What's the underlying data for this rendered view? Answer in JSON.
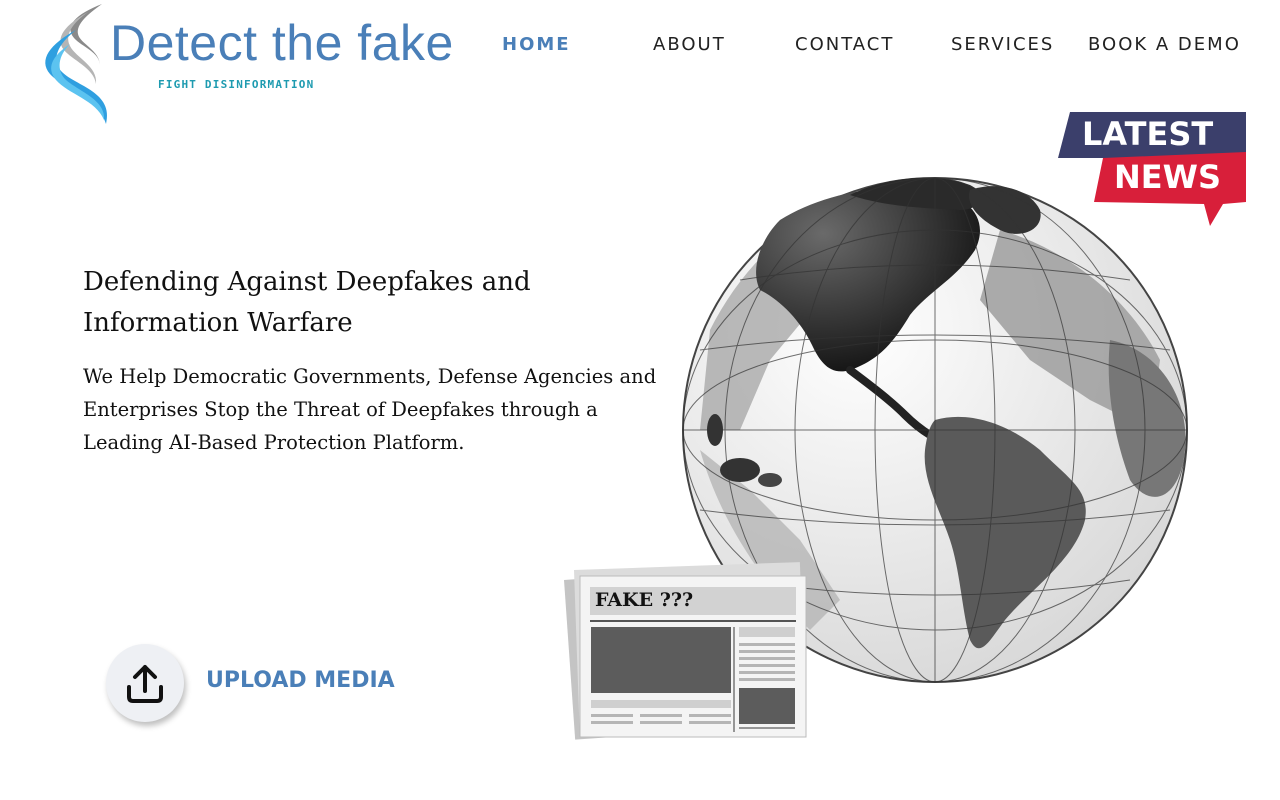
{
  "brand": {
    "name": "Detect the fake",
    "tagline": "FIGHT DISINFORMATION",
    "color": "#4a7fb8",
    "tagline_color": "#1e9bb0"
  },
  "nav": {
    "items": [
      {
        "label": "HOME",
        "active": true
      },
      {
        "label": "ABOUT",
        "active": false
      },
      {
        "label": "CONTACT",
        "active": false
      },
      {
        "label": "SERVICES",
        "active": false
      },
      {
        "label": "BOOK A DEMO",
        "active": false
      }
    ]
  },
  "hero": {
    "title": "Defending Against Deepfakes and Information Warfare",
    "subtitle": "We Help Democratic Governments, Defense Agencies and Enterprises Stop the Threat of Deepfakes through a Leading AI-Based Protection Platform.",
    "upload_label": "UPLOAD MEDIA",
    "upload_icon": "upload-icon"
  },
  "illustration": {
    "badge_line1": "LATEST",
    "badge_line2": "NEWS",
    "badge_colors": {
      "dark": "#3b3f6b",
      "red": "#d81f3a"
    },
    "newspaper_headline": "FAKE ???",
    "globe_icon": "globe-illustration"
  }
}
